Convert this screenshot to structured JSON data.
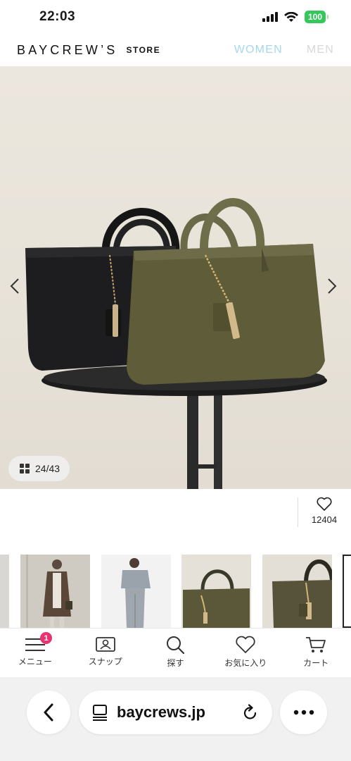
{
  "status_bar": {
    "time": "22:03",
    "battery": "100"
  },
  "header": {
    "logo": "BAYCREW’S",
    "logo_sub": "STORE",
    "nav": [
      "WOMEN",
      "MEN"
    ]
  },
  "gallery": {
    "counter": "24/43",
    "favorite_count": "12404"
  },
  "tabbar": {
    "badge": "1",
    "items": [
      {
        "label": "メニュー",
        "icon": "menu-icon"
      },
      {
        "label": "スナップ",
        "icon": "snap-icon"
      },
      {
        "label": "探す",
        "icon": "search-icon"
      },
      {
        "label": "お気に入り",
        "icon": "heart-icon"
      },
      {
        "label": "カート",
        "icon": "cart-icon"
      }
    ]
  },
  "browser": {
    "url": "baycrews.jp"
  },
  "colors": {
    "accent_women": "#a7d7ee",
    "badge": "#e8336f",
    "battery": "#34c759"
  }
}
